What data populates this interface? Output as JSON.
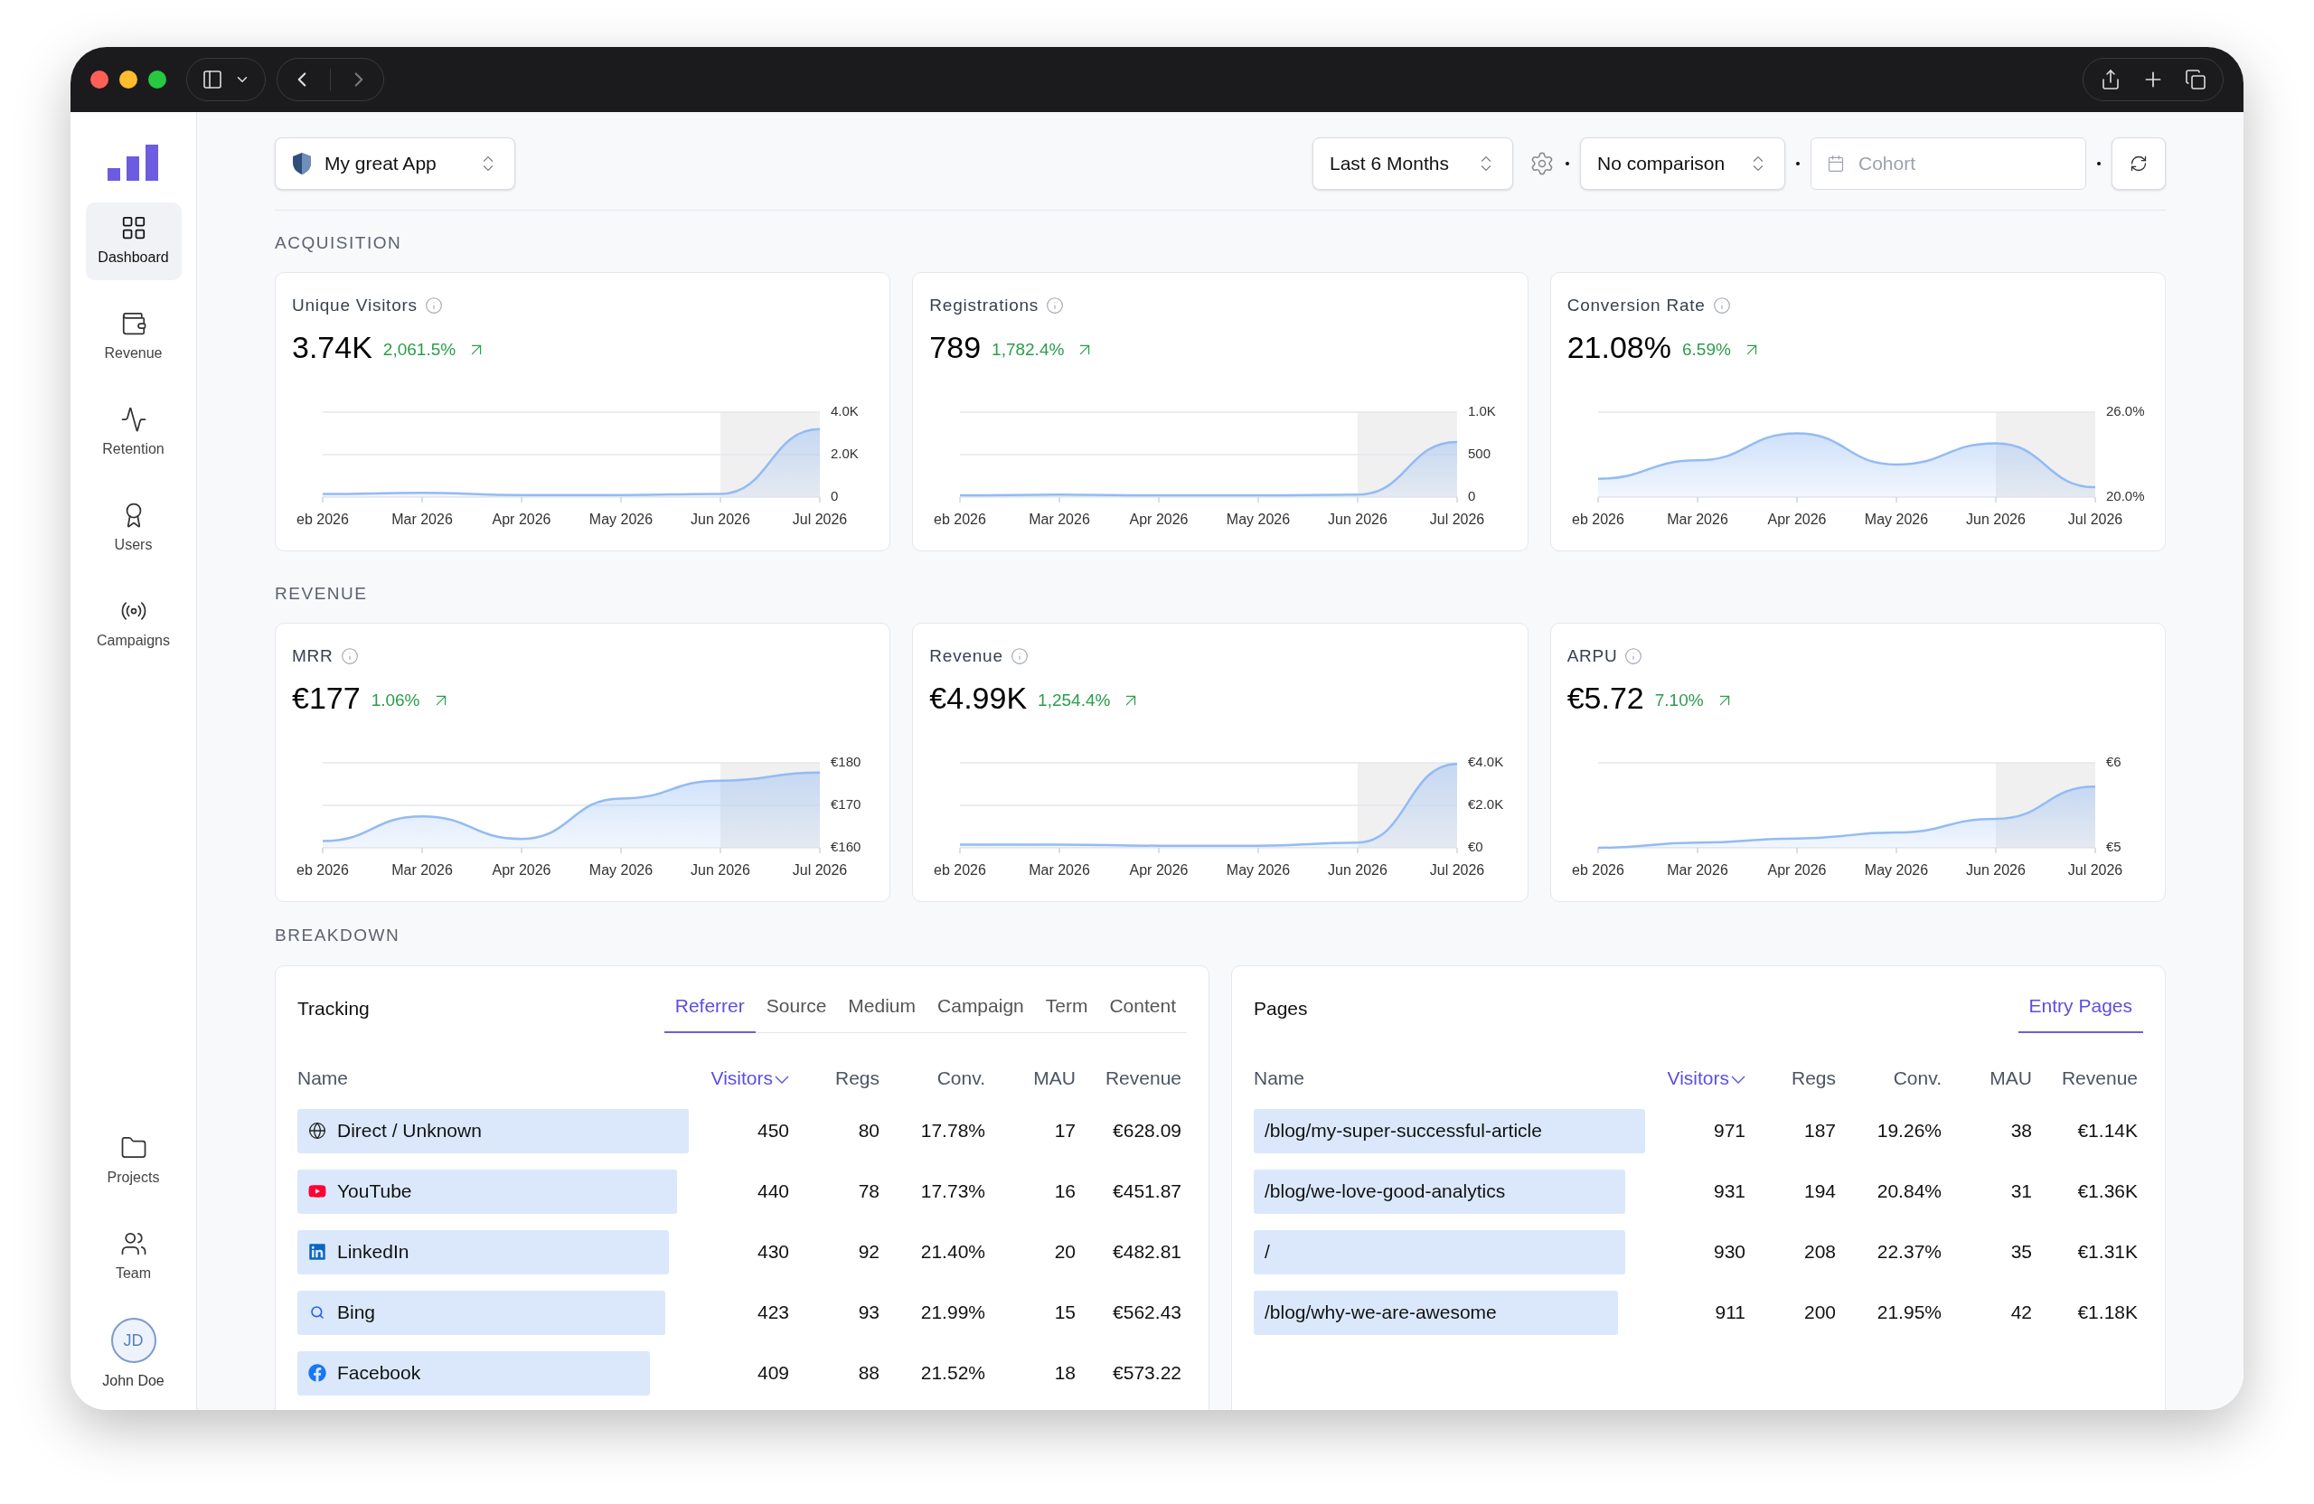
{
  "app_selector": {
    "value": "My great App"
  },
  "filters": {
    "period": "Last 6 Months",
    "comparison": "No comparison",
    "cohort": {
      "placeholder": "Cohort"
    }
  },
  "sidebar": {
    "items": [
      {
        "label": "Dashboard",
        "selected": true
      },
      {
        "label": "Revenue",
        "selected": false
      },
      {
        "label": "Retention",
        "selected": false
      },
      {
        "label": "Users",
        "selected": false
      },
      {
        "label": "Campaigns",
        "selected": false
      }
    ],
    "footer_items": [
      {
        "label": "Projects",
        "selected": false
      },
      {
        "label": "Team",
        "selected": false
      }
    ],
    "user": {
      "initials": "JD",
      "name": "John Doe"
    }
  },
  "sections": [
    {
      "title": "ACQUISITION",
      "cards": [
        {
          "title": "Unique Visitors",
          "value": "3.74K",
          "change": "2,061.5%",
          "increase": true,
          "last_period_shaded": true,
          "chart_data": {
            "type": "area",
            "categories": [
              "eb 2026",
              "Mar 2026",
              "Apr 2026",
              "May 2026",
              "Jun 2026",
              "Jul 2026"
            ],
            "series": [
              {
                "color": "#93bbf3",
                "values": [
                  150,
                  200,
                  100,
                  100,
                  150,
                  3200
                ]
              }
            ],
            "ylim": [
              0,
              4000
            ],
            "yticks": [
              {
                "value": 0,
                "label": "0"
              },
              {
                "value": 2000,
                "label": "2.0K"
              },
              {
                "value": 4000,
                "label": "4.0K"
              }
            ]
          }
        },
        {
          "title": "Registrations",
          "value": "789",
          "change": "1,782.4%",
          "increase": true,
          "last_period_shaded": true,
          "chart_data": {
            "type": "area",
            "categories": [
              "eb 2026",
              "Mar 2026",
              "Apr 2026",
              "May 2026",
              "Jun 2026",
              "Jul 2026"
            ],
            "series": [
              {
                "color": "#93bbf3",
                "values": [
                  20,
                  30,
                  20,
                  20,
                  30,
                  650
                ]
              }
            ],
            "ylim": [
              0,
              1000
            ],
            "yticks": [
              {
                "value": 0,
                "label": "0"
              },
              {
                "value": 500,
                "label": "500"
              },
              {
                "value": 1000,
                "label": "1.0K"
              }
            ]
          }
        },
        {
          "title": "Conversion Rate",
          "value": "21.08%",
          "change": "6.59%",
          "increase": true,
          "last_period_shaded": true,
          "chart_data": {
            "type": "area",
            "categories": [
              "eb 2026",
              "Mar 2026",
              "Apr 2026",
              "May 2026",
              "Jun 2026",
              "Jul 2026"
            ],
            "series": [
              {
                "color": "#93bbf3",
                "values": [
                  21.3,
                  22.6,
                  24.5,
                  22.3,
                  23.8,
                  20.7
                ]
              }
            ],
            "ylim": [
              20,
              26
            ],
            "yticks": [
              {
                "value": 20,
                "label": "20.0%"
              },
              {
                "value": 26,
                "label": "26.0%"
              }
            ]
          }
        }
      ]
    },
    {
      "title": "REVENUE",
      "cards": [
        {
          "title": "MRR",
          "value": "€177",
          "change": "1.06%",
          "increase": true,
          "last_period_shaded": true,
          "chart_data": {
            "type": "area",
            "categories": [
              "eb 2026",
              "Mar 2026",
              "Apr 2026",
              "May 2026",
              "Jun 2026",
              "Jul 2026"
            ],
            "series": [
              {
                "color": "#93bbf3",
                "values": [
                  161.6,
                  167.4,
                  162.1,
                  171.6,
                  175.8,
                  177.7
                ]
              }
            ],
            "ylim": [
              160,
              180
            ],
            "yticks": [
              {
                "value": 160,
                "label": "€160"
              },
              {
                "value": 170,
                "label": "€170"
              },
              {
                "value": 180,
                "label": "€180"
              }
            ]
          }
        },
        {
          "title": "Revenue",
          "value": "€4.99K",
          "change": "1,254.4%",
          "increase": true,
          "last_period_shaded": true,
          "chart_data": {
            "type": "area",
            "categories": [
              "eb 2026",
              "Mar 2026",
              "Apr 2026",
              "May 2026",
              "Jun 2026",
              "Jul 2026"
            ],
            "series": [
              {
                "color": "#93bbf3",
                "values": [
                  150,
                  150,
                  100,
                  100,
                  250,
                  3950
                ]
              }
            ],
            "ylim": [
              0,
              4000
            ],
            "yticks": [
              {
                "value": 0,
                "label": "€0"
              },
              {
                "value": 2000,
                "label": "€2.0K"
              },
              {
                "value": 4000,
                "label": "€4.0K"
              }
            ]
          }
        },
        {
          "title": "ARPU",
          "value": "€5.72",
          "change": "7.10%",
          "increase": true,
          "last_period_shaded": true,
          "chart_data": {
            "type": "area",
            "categories": [
              "eb 2026",
              "Mar 2026",
              "Apr 2026",
              "May 2026",
              "Jun 2026",
              "Jul 2026"
            ],
            "series": [
              {
                "color": "#93bbf3",
                "values": [
                  5.0,
                  5.06,
                  5.11,
                  5.18,
                  5.34,
                  5.72
                ]
              }
            ],
            "ylim": [
              5,
              6
            ],
            "yticks": [
              {
                "value": 5,
                "label": "€5"
              },
              {
                "value": 6,
                "label": "€6"
              }
            ]
          }
        }
      ]
    }
  ],
  "breakdown": {
    "title": "BREAKDOWN",
    "panels": [
      {
        "title": "Tracking",
        "kind": "referrer",
        "tabs": [
          {
            "label": "Referrer",
            "selected": true
          },
          {
            "label": "Source",
            "selected": false
          },
          {
            "label": "Medium",
            "selected": false
          },
          {
            "label": "Campaign",
            "selected": false
          },
          {
            "label": "Term",
            "selected": false
          },
          {
            "label": "Content",
            "selected": false
          }
        ],
        "columns": [
          {
            "label": "Name",
            "sorted": false
          },
          {
            "label": "Visitors",
            "sorted": true
          },
          {
            "label": "Regs",
            "sorted": false
          },
          {
            "label": "Conv.",
            "sorted": false
          },
          {
            "label": "MAU",
            "sorted": false
          },
          {
            "label": "Revenue",
            "sorted": false
          }
        ],
        "rows": [
          {
            "level": 1,
            "cells": [
              "Direct / Unknown",
              "450",
              "80",
              "17.78%",
              "17",
              "€628.09"
            ]
          },
          {
            "level": 0.97,
            "cells": [
              "YouTube",
              "440",
              "78",
              "17.73%",
              "16",
              "€451.87"
            ]
          },
          {
            "level": 0.95,
            "cells": [
              "LinkedIn",
              "430",
              "92",
              "21.40%",
              "20",
              "€482.81"
            ]
          },
          {
            "level": 0.94,
            "cells": [
              "Bing",
              "423",
              "93",
              "21.99%",
              "15",
              "€562.43"
            ]
          },
          {
            "level": 0.9,
            "cells": [
              "Facebook",
              "409",
              "88",
              "21.52%",
              "18",
              "€573.22"
            ]
          }
        ]
      },
      {
        "title": "Pages",
        "kind": "page",
        "tabs": [
          {
            "label": "Entry Pages",
            "selected": true
          }
        ],
        "columns": [
          {
            "label": "Name",
            "sorted": false
          },
          {
            "label": "Visitors",
            "sorted": true
          },
          {
            "label": "Regs",
            "sorted": false
          },
          {
            "label": "Conv.",
            "sorted": false
          },
          {
            "label": "MAU",
            "sorted": false
          },
          {
            "label": "Revenue",
            "sorted": false
          }
        ],
        "rows": [
          {
            "level": 1,
            "cells": [
              "/blog/my-super-successful-article",
              "971",
              "187",
              "19.26%",
              "38",
              "€1.14K"
            ]
          },
          {
            "level": 0.95,
            "cells": [
              "/blog/we-love-good-analytics",
              "931",
              "194",
              "20.84%",
              "31",
              "€1.36K"
            ]
          },
          {
            "level": 0.95,
            "cells": [
              "/",
              "930",
              "208",
              "22.37%",
              "35",
              "€1.31K"
            ]
          },
          {
            "level": 0.93,
            "cells": [
              "/blog/why-we-are-awesome",
              "911",
              "200",
              "21.95%",
              "42",
              "€1.18K"
            ]
          }
        ]
      }
    ]
  }
}
